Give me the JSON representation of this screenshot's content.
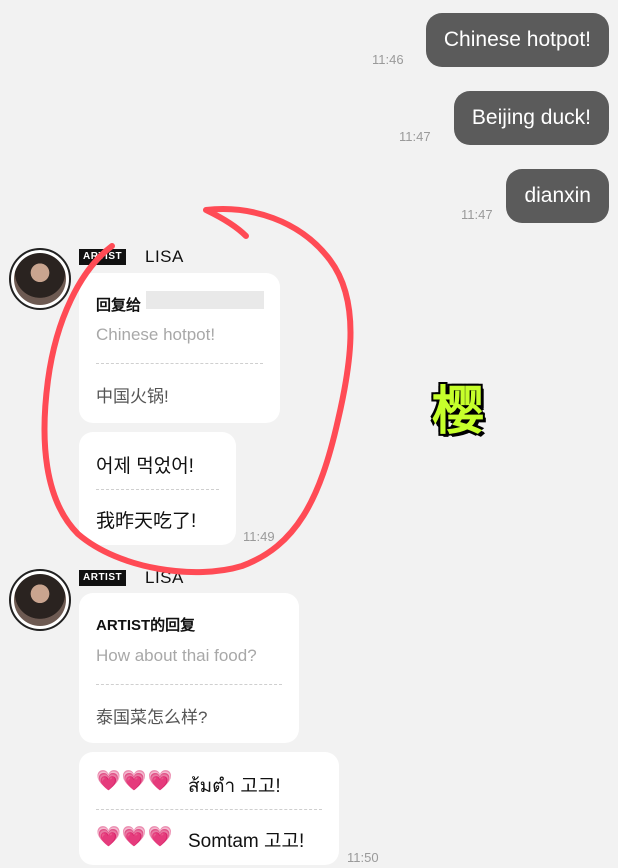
{
  "outgoing": [
    {
      "text": "Chinese hotpot!",
      "time": "11:46"
    },
    {
      "text": "Beijing duck!",
      "time": "11:47"
    },
    {
      "text": "dianxin",
      "time": "11:47"
    }
  ],
  "group1": {
    "tag": "ARTIST",
    "name": "LISA",
    "reply_title": "回复给",
    "reply_quote": "Chinese hotpot!",
    "reply_translation": "中国火锅!",
    "message_original": "어제 먹었어!",
    "message_translation": "我昨天吃了!",
    "time": "11:49"
  },
  "group2": {
    "tag": "ARTIST",
    "name": "LISA",
    "reply_title": "ARTIST的回复",
    "reply_quote": "How about thai food?",
    "reply_translation": "泰国菜怎么样?",
    "message_original": "ส้มตำ 고고!",
    "message_translation": "Somtam 고고!",
    "time": "11:50"
  },
  "hearts": "💗💗💗",
  "watermark": "樱",
  "colors": {
    "background": "#f2f2f2",
    "outgoing_bubble": "#5b5b5b",
    "annotation_circle": "#ff4b55",
    "watermark": "#c6ff2b"
  }
}
